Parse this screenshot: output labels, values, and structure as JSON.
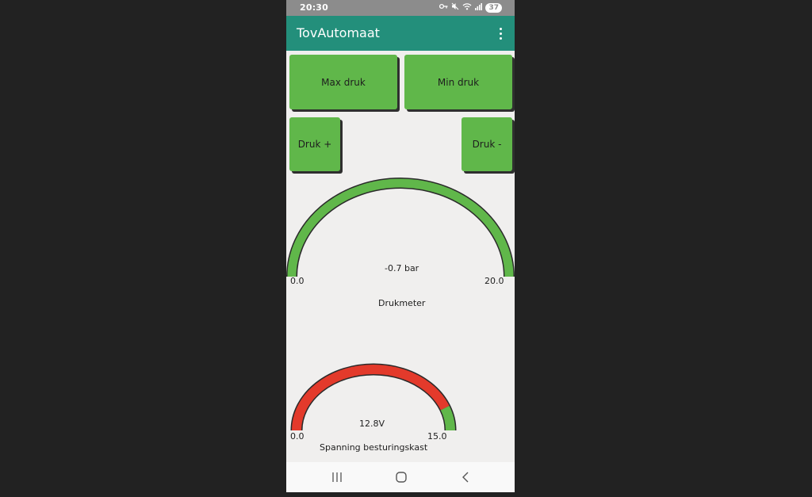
{
  "status_bar": {
    "time": "20:30",
    "icons": [
      "key-icon",
      "mute-icon",
      "wifi-icon",
      "signal-icon"
    ],
    "battery": "37"
  },
  "app_bar": {
    "title": "TovAutomaat",
    "menu_icon": "more-vert-icon"
  },
  "buttons": {
    "max_druk": "Max druk",
    "min_druk": "Min druk",
    "druk_plus": "Druk +",
    "druk_minus": "Druk -"
  },
  "pressure_gauge": {
    "value_text": "-0.7 bar",
    "min_label": "0.0",
    "max_label": "20.0",
    "title": "Drukmeter",
    "color": "#60b74a"
  },
  "voltage_gauge": {
    "value_text": "12.8V",
    "min_label": "0.0",
    "max_label": "15.0",
    "title": "Spanning besturingskast",
    "range_min": 0,
    "range_max": 15,
    "red_until": 13.2,
    "red_color": "#e33a2b",
    "green_color": "#60b74a"
  },
  "nav_bar": {
    "recents_icon": "recents-icon",
    "home_icon": "home-icon",
    "back_icon": "back-icon"
  }
}
